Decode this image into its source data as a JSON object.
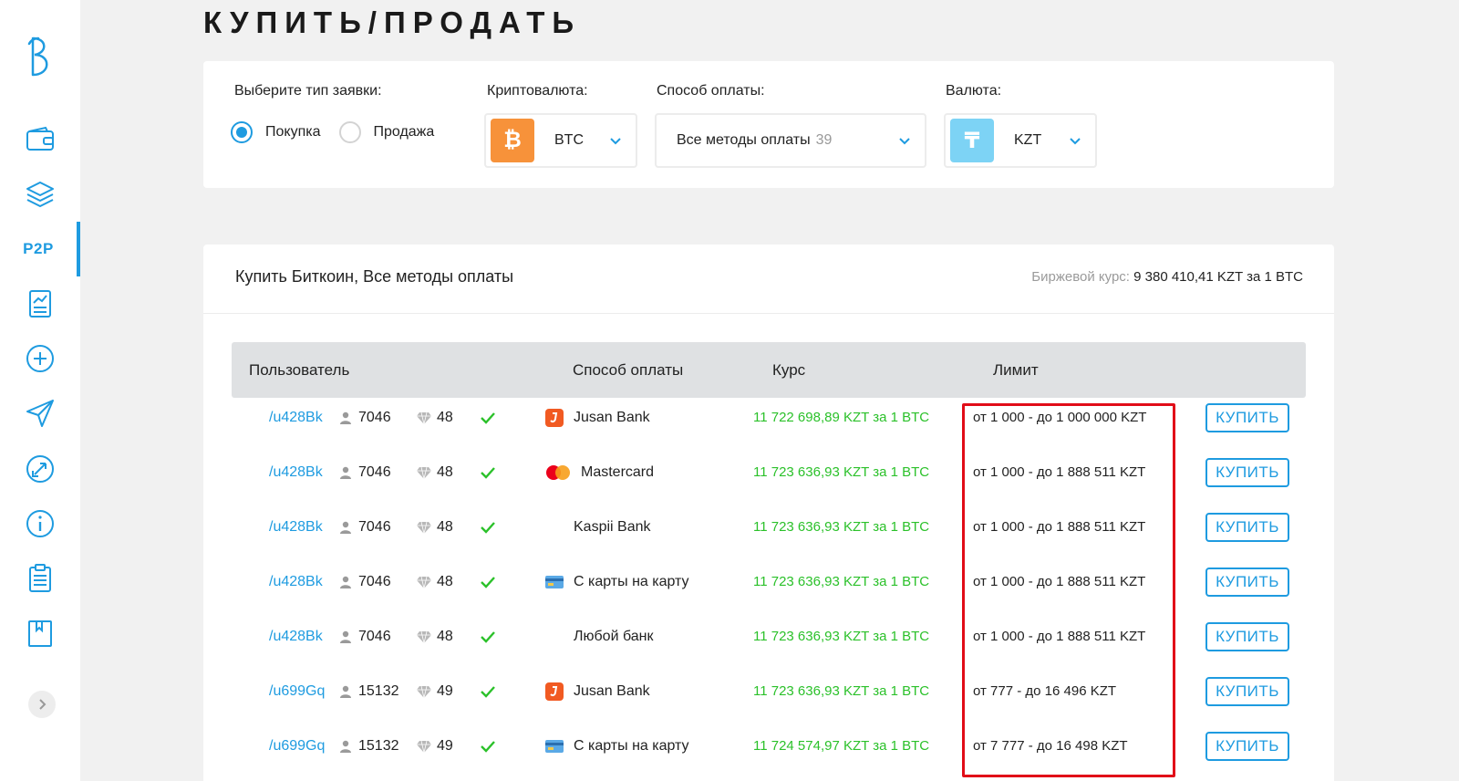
{
  "page": {
    "title": "КУПИТЬ/ПРОДАТЬ"
  },
  "sidebar": {
    "logo_icon": "b-logo-icon",
    "items": [
      {
        "name": "wallet-icon"
      },
      {
        "name": "layers-icon"
      },
      {
        "name": "p2p",
        "label": "P2P",
        "active": true
      },
      {
        "name": "chart-report-icon"
      },
      {
        "name": "plus-circle-icon"
      },
      {
        "name": "send-icon"
      },
      {
        "name": "exchange-circle-icon"
      },
      {
        "name": "info-icon"
      },
      {
        "name": "clipboard-icon"
      },
      {
        "name": "book-icon"
      }
    ],
    "expand_icon": "chevron-right-icon"
  },
  "filters": {
    "order_type_label": "Выберите тип заявки:",
    "buy_label": "Покупка",
    "sell_label": "Продажа",
    "selected_type": "buy",
    "crypto_label": "Криптовалюта:",
    "crypto_value": "BTC",
    "crypto_icon": "bitcoin-icon",
    "payment_label": "Способ оплаты:",
    "payment_value": "Все методы оплаты",
    "payment_count": "39",
    "currency_label": "Валюта:",
    "currency_value": "KZT",
    "currency_icon": "tenge-icon"
  },
  "offers": {
    "title": "Купить Биткоин, Все методы оплаты",
    "rate_label": "Биржевой курс:",
    "rate_value": "9 380 410,41 KZT за 1 BTC",
    "columns": {
      "user": "Пользователь",
      "payment": "Способ оплаты",
      "rate": "Курс",
      "limit": "Лимит"
    },
    "buy_button_label": "КУПИТЬ",
    "rows": [
      {
        "user": "/u428Bk",
        "deals": "7046",
        "rating": "48",
        "payment": "Jusan Bank",
        "payment_icon": "jusan",
        "rate": "11 722 698,89 KZT за 1 BTC",
        "limit": "от 1 000 - до 1 000 000 KZT"
      },
      {
        "user": "/u428Bk",
        "deals": "7046",
        "rating": "48",
        "payment": "Mastercard",
        "payment_icon": "mastercard",
        "rate": "11 723 636,93 KZT за 1 BTC",
        "limit": "от 1 000 - до 1 888 511 KZT"
      },
      {
        "user": "/u428Bk",
        "deals": "7046",
        "rating": "48",
        "payment": "Kaspii Bank",
        "payment_icon": "none",
        "rate": "11 723 636,93 KZT за 1 BTC",
        "limit": "от 1 000 - до 1 888 511 KZT"
      },
      {
        "user": "/u428Bk",
        "deals": "7046",
        "rating": "48",
        "payment": "С карты на карту",
        "payment_icon": "card",
        "rate": "11 723 636,93 KZT за 1 BTC",
        "limit": "от 1 000 - до 1 888 511 KZT"
      },
      {
        "user": "/u428Bk",
        "deals": "7046",
        "rating": "48",
        "payment": "Любой банк",
        "payment_icon": "none",
        "rate": "11 723 636,93 KZT за 1 BTC",
        "limit": "от 1 000 - до 1 888 511 KZT"
      },
      {
        "user": "/u699Gq",
        "deals": "15132",
        "rating": "49",
        "payment": "Jusan Bank",
        "payment_icon": "jusan",
        "rate": "11 723 636,93 KZT за 1 BTC",
        "limit": "от 777 - до 16 496 KZT"
      },
      {
        "user": "/u699Gq",
        "deals": "15132",
        "rating": "49",
        "payment": "С карты на карту",
        "payment_icon": "card",
        "rate": "11 724 574,97 KZT за 1 BTC",
        "limit": "от 7 777 - до 16 498 KZT"
      }
    ]
  },
  "colors": {
    "accent": "#1e9be0",
    "rate_green": "#2bc12a",
    "highlight_red": "#e10d18",
    "btc_orange": "#f7923a",
    "tenge_blue": "#7dd3f5"
  }
}
